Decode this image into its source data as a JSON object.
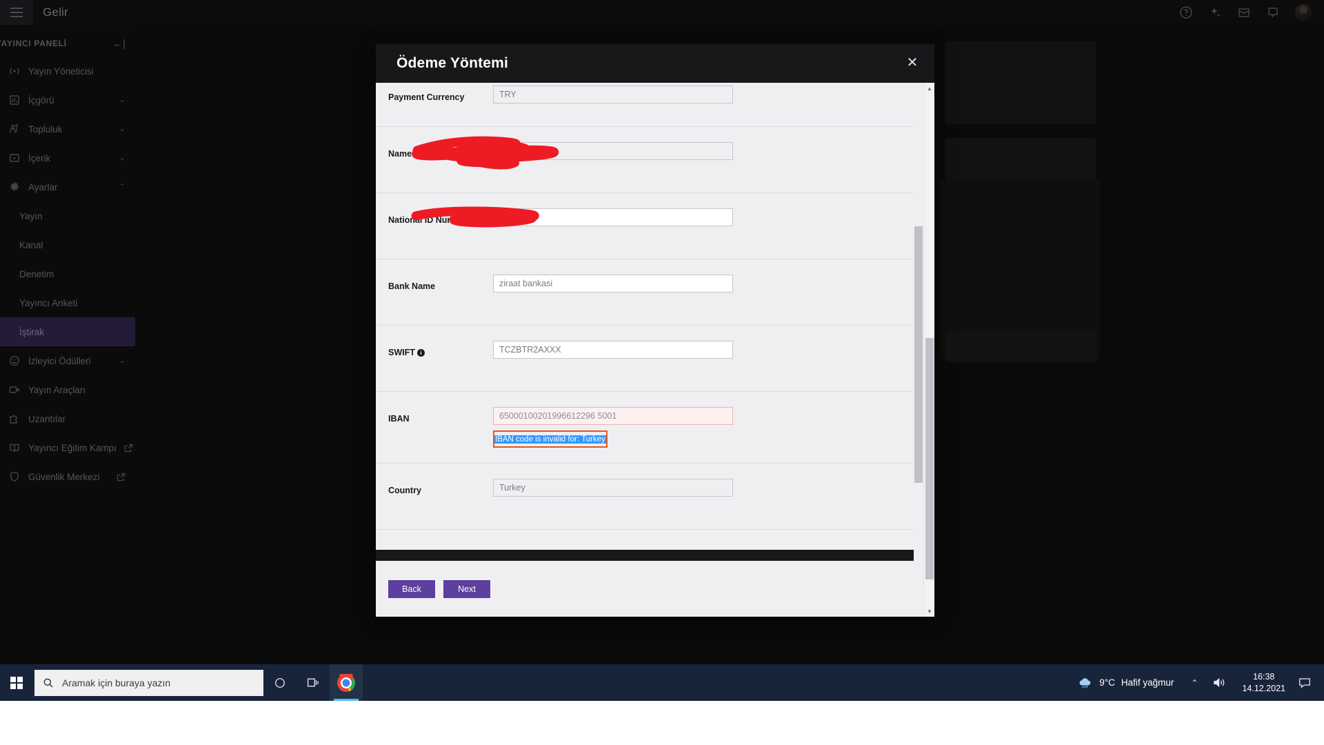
{
  "app": {
    "title": "Gelir",
    "topnav_icons": [
      "help-icon",
      "sparkle-icon",
      "inbox-icon",
      "chat-icon"
    ],
    "avatar": "avatar"
  },
  "sidebar": {
    "heading": "YAYINCI PANELİ",
    "collapse_icon": "collapse-sidebar-icon",
    "items": [
      {
        "label": "Yayın Yöneticisi",
        "icon": "broadcast-icon",
        "type": "link",
        "active": false
      },
      {
        "label": "İçgörü",
        "icon": "insights-icon",
        "type": "expandable",
        "chevron": "chevron-down-icon",
        "active": false
      },
      {
        "label": "Topluluk",
        "icon": "community-icon",
        "type": "expandable",
        "chevron": "chevron-down-icon",
        "active": false
      },
      {
        "label": "İçerik",
        "icon": "content-icon",
        "type": "expandable",
        "chevron": "chevron-down-icon",
        "active": false
      },
      {
        "label": "Ayarlar",
        "icon": "gear-icon",
        "type": "expandable",
        "chevron": "chevron-up-icon",
        "active": false
      },
      {
        "label": "Yayın",
        "icon": "",
        "type": "sub",
        "active": false
      },
      {
        "label": "Kanal",
        "icon": "",
        "type": "sub",
        "active": false
      },
      {
        "label": "Denetim",
        "icon": "",
        "type": "sub",
        "active": false
      },
      {
        "label": "Yayıncı Anketi",
        "icon": "",
        "type": "sub",
        "active": false
      },
      {
        "label": "İştirak",
        "icon": "",
        "type": "sub",
        "active": true
      },
      {
        "label": "İzleyici Ödülleri",
        "icon": "smile-icon",
        "type": "expandable",
        "chevron": "chevron-down-icon",
        "active": false
      },
      {
        "label": "Yayın Araçları",
        "icon": "camera-icon",
        "type": "link",
        "active": false
      },
      {
        "label": "Uzantılar",
        "icon": "extension-icon",
        "type": "link",
        "active": false
      },
      {
        "label": "Yayıncı Eğitim Kampı",
        "icon": "book-icon",
        "type": "external",
        "external_icon": "external-link-icon",
        "active": false
      },
      {
        "label": "Güvenlik Merkezi",
        "icon": "shield-icon",
        "type": "external",
        "external_icon": "external-link-icon",
        "active": false
      }
    ]
  },
  "modal": {
    "title": "Ödeme Yöntemi",
    "close_icon": "close-icon",
    "fields": [
      {
        "label": "Payment Currency",
        "value": "TRY",
        "style": "grey",
        "info": false,
        "redacted": false,
        "error": ""
      },
      {
        "label": "Name on Account",
        "value": "",
        "style": "grey",
        "info": false,
        "redacted": true,
        "error": ""
      },
      {
        "label": "National ID Number",
        "value": "",
        "style": "white",
        "info": true,
        "redacted": true,
        "error": ""
      },
      {
        "label": "Bank Name",
        "value": "ziraat bankasi",
        "style": "white",
        "info": false,
        "redacted": false,
        "error": ""
      },
      {
        "label": "SWIFT",
        "value": "TCZBTR2AXXX",
        "style": "white",
        "info": true,
        "redacted": false,
        "error": ""
      },
      {
        "label": "IBAN",
        "value": "65000100201996612296 5001",
        "style": "error",
        "info": false,
        "redacted": false,
        "error": "IBAN code is invalid for: Turkey"
      },
      {
        "label": "Country",
        "value": "Turkey",
        "style": "grey",
        "info": false,
        "redacted": false,
        "error": ""
      }
    ],
    "footer": {
      "back_label": "Back",
      "next_label": "Next"
    },
    "colors": {
      "button": "#5c3f9e",
      "error_border": "#e2581e",
      "selection": "#3297fd",
      "redaction": "#ee1b24"
    }
  },
  "taskbar": {
    "start_icon": "windows-start-icon",
    "search_icon": "search-icon",
    "search_placeholder": "Aramak için buraya yazın",
    "cortana_icon": "cortana-icon",
    "taskview_icon": "task-view-icon",
    "chrome_icon": "chrome-icon",
    "weather": {
      "icon": "rain-cloud-icon",
      "temperature": "9°C",
      "condition": "Hafif yağmur"
    },
    "tray_chevron_icon": "chevron-up-icon",
    "volume_icon": "volume-icon",
    "time": "16:38",
    "date": "14.12.2021",
    "notification_icon": "notification-icon"
  }
}
